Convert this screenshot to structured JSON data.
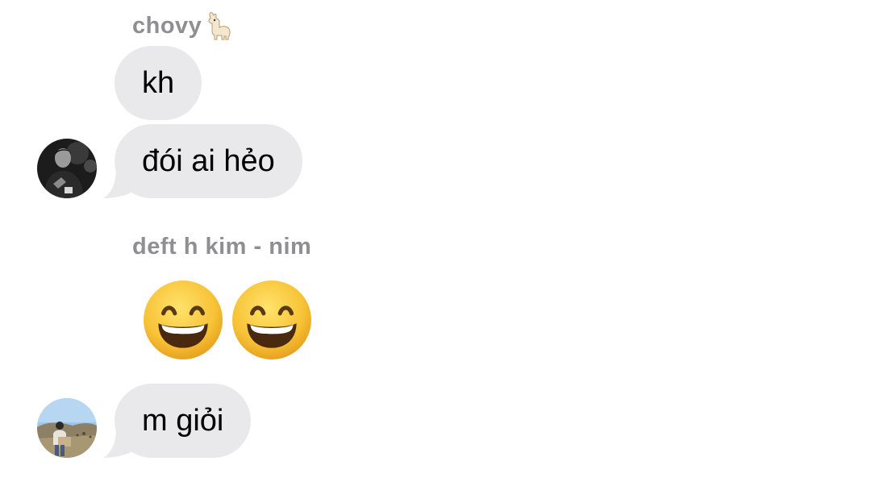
{
  "messages": {
    "group1": {
      "sender": "chovy",
      "sender_badge": "llama-icon",
      "bubble1": "kh",
      "bubble2": "đói ai hẻo"
    },
    "group2": {
      "sender": "deft h kim - nim",
      "emoji_count": 2,
      "emoji": "grinning-face-with-smiling-eyes",
      "bubble1": "m giỏi"
    }
  },
  "colors": {
    "bubble": "#e9e9eb",
    "sender": "#8e8e93",
    "text": "#000000",
    "emoji_yellow": "#f7c236"
  }
}
